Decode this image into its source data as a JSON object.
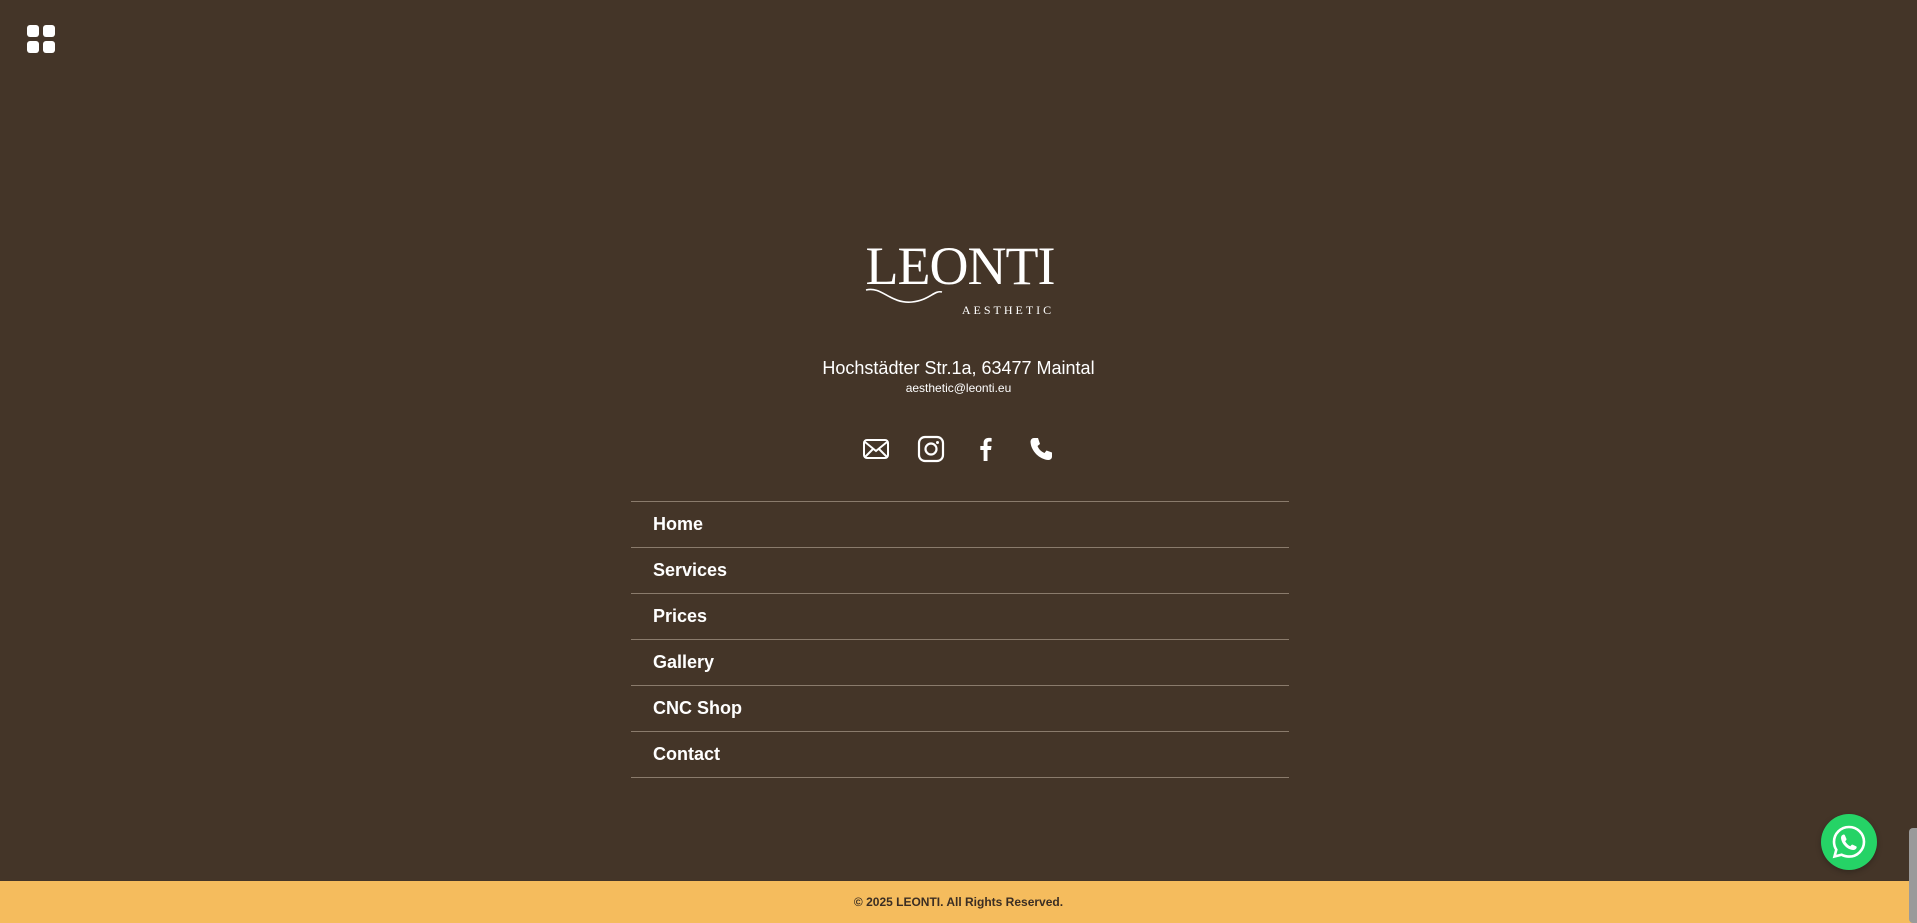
{
  "header": {
    "menu_icon": "grid-menu-icon"
  },
  "brand": {
    "name": "LEONTI",
    "tagline": "AESTHETIC"
  },
  "contact": {
    "address": "Hochstädter Str.1a, 63477 Maintal",
    "email": "aesthetic@leonti.eu"
  },
  "socials": [
    {
      "icon": "email-icon"
    },
    {
      "icon": "instagram-icon"
    },
    {
      "icon": "facebook-icon"
    },
    {
      "icon": "phone-icon"
    }
  ],
  "nav": {
    "items": [
      {
        "label": "Home"
      },
      {
        "label": "Services"
      },
      {
        "label": "Prices"
      },
      {
        "label": "Gallery"
      },
      {
        "label": "CNC Shop"
      },
      {
        "label": "Contact"
      }
    ]
  },
  "footer": {
    "copyright": "© 2025 LEONTI. All Rights Reserved."
  },
  "whatsapp": {
    "icon": "whatsapp-icon"
  },
  "colors": {
    "background": "#443528",
    "footer": "#f5bc5d",
    "whatsapp": "#25d366",
    "text": "#ffffff"
  }
}
